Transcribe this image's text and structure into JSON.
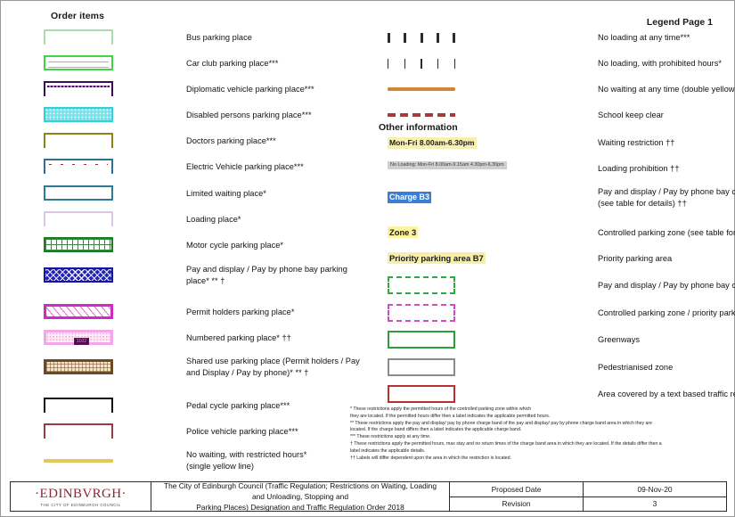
{
  "headings": {
    "order_items": "Order items",
    "legend_page": "Legend Page 1",
    "other_information": "Other information"
  },
  "order_items": [
    {
      "label": "Bus parking place",
      "symbol": "bracket-pale-green"
    },
    {
      "label": "Car club parking place***",
      "symbol": "box-green-lines"
    },
    {
      "label": "Diplomatic vehicle parking place***",
      "symbol": "bracket-purple-dotted"
    },
    {
      "label": "Disabled persons parking place***",
      "symbol": "box-cyan-dots"
    },
    {
      "label": "Doctors parking place***",
      "symbol": "bracket-olive"
    },
    {
      "label": "Electric Vehicle parking place***",
      "symbol": "bracket-steel-blue"
    },
    {
      "label": "Limited waiting place*",
      "symbol": "box-teal"
    },
    {
      "label": "Loading place*",
      "symbol": "bracket-pale-lilac"
    },
    {
      "label": "Motor cycle  parking place*",
      "symbol": "box-green-grid"
    },
    {
      "label": "Pay and display / Pay by phone bay parking\nplace*  **  †",
      "symbol": "box-blue-cross"
    },
    {
      "label": "Permit holders parking place*",
      "symbol": "box-magenta-diag"
    },
    {
      "label": "Numbered parking place* ††",
      "symbol": "box-pink-plate"
    },
    {
      "label": "Shared use parking place (Permit holders / Pay\nand Display / Pay by phone)*  **  †",
      "symbol": "box-brown-basket"
    },
    {
      "label": "Pedal cycle parking place***",
      "symbol": "bracket-black"
    },
    {
      "label": "Police vehicle parking place***",
      "symbol": "bracket-maroon"
    },
    {
      "label": "No waiting, with restricted hours*\n(single yellow line)",
      "symbol": "bar-yellow"
    }
  ],
  "restriction_items": [
    {
      "label": "No loading at any time***",
      "symbol": "ticks-thick"
    },
    {
      "label": "No loading, with prohibited hours*",
      "symbol": "ticks-thin"
    },
    {
      "label": "No waiting at any time (double yellow line)***",
      "symbol": "line-orange"
    },
    {
      "label": "School keep clear",
      "symbol": "dashes-red"
    }
  ],
  "other_information": [
    {
      "label": "Waiting restriction ††",
      "chip": "Mon-Fri 8.00am-6.30pm",
      "chip_style": "yellow"
    },
    {
      "label": "Loading prohibition ††",
      "chip": "No Loading: Mon-Fri 8.00am-9.15am\n4.30pm-6.30pm",
      "chip_style": "grey"
    },
    {
      "label": "Pay and display / Pay by phone bay charge band\n(see table for details)  ††",
      "chip": "Charge B3",
      "chip_style": "blue"
    },
    {
      "label": "Controlled parking zone (see table for details)  ††",
      "chip": "Zone 3",
      "chip_style": "zone"
    },
    {
      "label": "Priority parking area",
      "chip": "Priority parking area B7",
      "chip_style": "prio"
    },
    {
      "label": "Pay and display / Pay by phone bay charge band area",
      "chip": "",
      "chip_style": "dashed-green"
    },
    {
      "label": "Controlled parking zone / priority parking area",
      "chip": "",
      "chip_style": "dashed-magenta"
    },
    {
      "label": "Greenways",
      "chip": "",
      "chip_style": "solid-green"
    },
    {
      "label": "Pedestrianised zone",
      "chip": "",
      "chip_style": "solid-grey"
    },
    {
      "label": "Area covered by a text based traffic regulation order",
      "chip": "",
      "chip_style": "solid-red"
    }
  ],
  "footnotes": [
    "* These restrictions apply the permitted hours of the controlled parking zone within which",
    "they are located. If the permitted hours differ then a label indicates the applicable permitted hours.",
    "** These restrictions apply the pay and display/ pay by phone charge band of the pay and display/ pay by phone charge band area in which they are",
    "located. If the charge band differs then a label indicates the applicable charge band.",
    "*** These restrictions apply at any time.",
    "† These restrictions apply the permitted hours, max stay and no return times of the  charge band area in which they are located. If the details differ then a",
    "label indicates the applicable details.",
    "†† Labels will differ dependent upon the area in which the restriction is located."
  ],
  "titleblock": {
    "logo_main": "·EDINBVRGH·",
    "logo_sub": "THE CITY OF EDINBURGH COUNCIL",
    "description": "The City of Edinburgh Council (Traffic Regulation; Restrictions on Waiting, Loading and Unloading, Stopping and\nParking Places) Designation and Traffic Regulation Order 2018",
    "proposed_date_label": "Proposed Date",
    "proposed_date_value": "09-Nov-20",
    "revision_label": "Revision",
    "revision_value": "3"
  },
  "colors": {
    "pale_green": "#a9dcae",
    "green": "#44d344",
    "purple": "#3c0b5e",
    "cyan": "#2fd2da",
    "olive": "#8d8317",
    "steel_blue": "#2e6f96",
    "teal": "#2d7a96",
    "pale_lilac": "#d9c6e2",
    "dark_green": "#1e7a27",
    "blue": "#2323b4",
    "magenta": "#cf2bc1",
    "pink": "#f2a8e8",
    "brown": "#6b4a24",
    "black": "#111111",
    "maroon": "#9b3a48",
    "yellow": "#e6c657",
    "orange": "#d08733",
    "red_dash": "#aa3a3a",
    "grey": "#8c8c8c",
    "red": "#b83030"
  }
}
